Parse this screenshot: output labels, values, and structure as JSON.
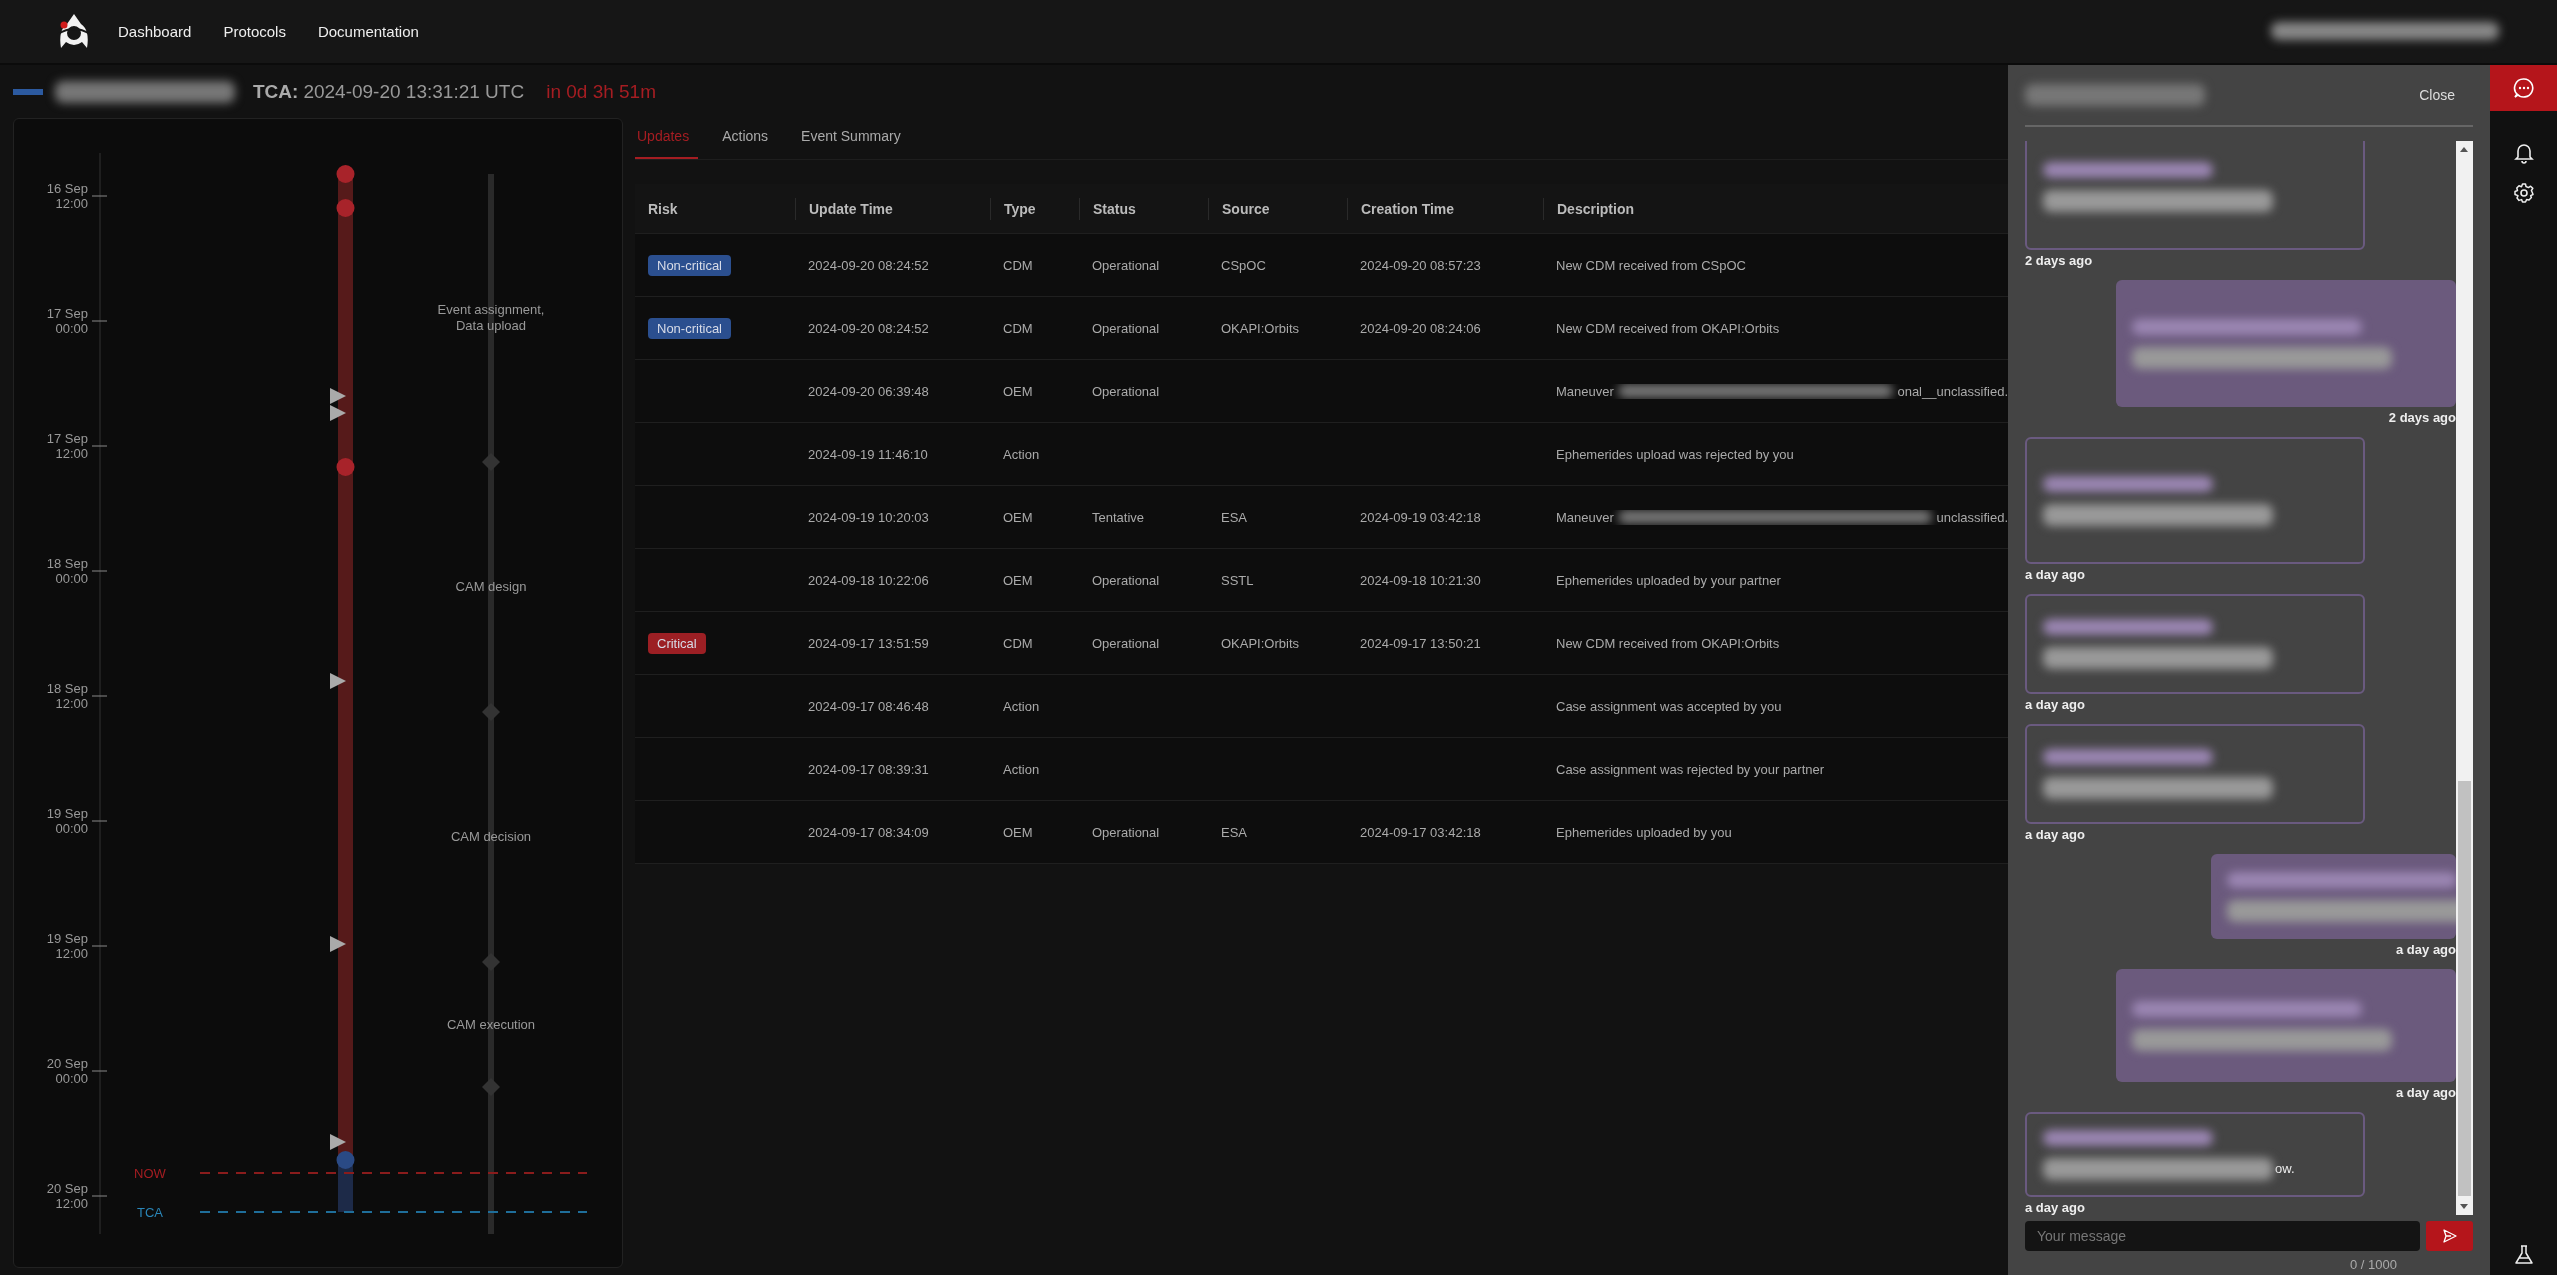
{
  "nav": [
    {
      "label": "Dashboard"
    },
    {
      "label": "Protocols"
    },
    {
      "label": "Documentation"
    }
  ],
  "event": {
    "tca_label": "TCA:",
    "tca": "2024-09-20 13:31:21 UTC",
    "countdown": "in 0d 3h 51m"
  },
  "timeline": {
    "ticks": [
      {
        "day": "16 Sep",
        "time": "12:00"
      },
      {
        "day": "17 Sep",
        "time": "00:00"
      },
      {
        "day": "17 Sep",
        "time": "12:00"
      },
      {
        "day": "18 Sep",
        "time": "00:00"
      },
      {
        "day": "18 Sep",
        "time": "12:00"
      },
      {
        "day": "19 Sep",
        "time": "00:00"
      },
      {
        "day": "19 Sep",
        "time": "12:00"
      },
      {
        "day": "20 Sep",
        "time": "00:00"
      },
      {
        "day": "20 Sep",
        "time": "12:00"
      }
    ],
    "events": [
      {
        "kind": "dot",
        "color": "#a8232a"
      },
      {
        "kind": "dot",
        "color": "#a8232a"
      },
      {
        "kind": "triangle"
      },
      {
        "kind": "triangle"
      },
      {
        "kind": "dot",
        "color": "#a8232a"
      },
      {
        "kind": "triangle"
      },
      {
        "kind": "triangle"
      },
      {
        "kind": "triangle"
      },
      {
        "kind": "dot",
        "color": "#2a4a85"
      }
    ],
    "phases": [
      {
        "lines": [
          "Event assignment,",
          "Data upload"
        ]
      },
      {
        "lines": [
          "CAM design"
        ]
      },
      {
        "lines": [
          "CAM decision"
        ]
      },
      {
        "lines": [
          "CAM execution"
        ]
      }
    ],
    "now": {
      "label": "NOW"
    },
    "tca": {
      "label": "TCA"
    }
  },
  "tabs": [
    {
      "label": "Updates",
      "selected": true
    },
    {
      "label": "Actions",
      "selected": false
    },
    {
      "label": "Event Summary",
      "selected": false
    }
  ],
  "table": {
    "columns": [
      "Risk",
      "Update Time",
      "Type",
      "Status",
      "Source",
      "Creation Time",
      "Description"
    ],
    "rows": [
      {
        "risk": {
          "label": "Non-critical",
          "color": "#2b4f8f"
        },
        "update_time": "2024-09-20 08:24:52",
        "type": "CDM",
        "status": "Operational",
        "source": "CSpOC",
        "creation_time": "2024-09-20 08:57:23",
        "description": "New CDM received from CSpOC"
      },
      {
        "risk": {
          "label": "Non-critical",
          "color": "#2b4f8f"
        },
        "update_time": "2024-09-20 08:24:52",
        "type": "CDM",
        "status": "Operational",
        "source": "OKAPI:Orbits",
        "creation_time": "2024-09-20 08:24:06",
        "description": "New CDM received from OKAPI:Orbits"
      },
      {
        "update_time": "2024-09-20 06:39:48",
        "type": "OEM",
        "status": "Operational",
        "description": "Maneuver",
        "redacted": true,
        "description_end": "onal__unclassified."
      },
      {
        "update_time": "2024-09-19 11:46:10",
        "type": "Action",
        "description": "Ephemerides upload was rejected by you"
      },
      {
        "update_time": "2024-09-19 10:20:03",
        "type": "OEM",
        "status": "Tentative",
        "source": "ESA",
        "creation_time": "2024-09-19 03:42:18",
        "description": "Maneuver",
        "redacted": true,
        "description_end": "unclassified."
      },
      {
        "update_time": "2024-09-18 10:22:06",
        "type": "OEM",
        "status": "Operational",
        "source": "SSTL",
        "creation_time": "2024-09-18 10:21:30",
        "description": "Ephemerides uploaded by your partner"
      },
      {
        "risk": {
          "label": "Critical",
          "color": "#9c1f24"
        },
        "update_time": "2024-09-17 13:51:59",
        "type": "CDM",
        "status": "Operational",
        "source": "OKAPI:Orbits",
        "creation_time": "2024-09-17 13:50:21",
        "description": "New CDM received from OKAPI:Orbits"
      },
      {
        "update_time": "2024-09-17 08:46:48",
        "type": "Action",
        "description": "Case assignment was accepted by you"
      },
      {
        "update_time": "2024-09-17 08:39:31",
        "type": "Action",
        "description": "Case assignment was rejected by your partner"
      },
      {
        "update_time": "2024-09-17 08:34:09",
        "type": "OEM",
        "status": "Operational",
        "source": "ESA",
        "creation_time": "2024-09-17 03:42:18",
        "description": "Ephemerides uploaded by you"
      }
    ]
  },
  "chat": {
    "close": "Close",
    "messages": [
      {
        "kind": "incoming",
        "time": "2 days ago"
      },
      {
        "kind": "outgoing",
        "time": "2 days ago"
      },
      {
        "kind": "incoming",
        "time": "a day ago"
      },
      {
        "kind": "incoming",
        "time": "a day ago"
      },
      {
        "kind": "incoming",
        "time": "a day ago"
      },
      {
        "kind": "outgoing",
        "time": "a day ago"
      },
      {
        "kind": "outgoing",
        "time": "a day ago"
      },
      {
        "kind": "incoming",
        "time": "a day ago",
        "text_end": "ow."
      }
    ],
    "input": {
      "placeholder": "Your message"
    },
    "counter": "0 / 1000"
  },
  "rail": [
    {
      "kind": "chat",
      "selected": true
    },
    {
      "kind": "bell",
      "selected": false
    },
    {
      "kind": "gear",
      "selected": false
    },
    {
      "kind": "flask",
      "selected": false
    }
  ]
}
